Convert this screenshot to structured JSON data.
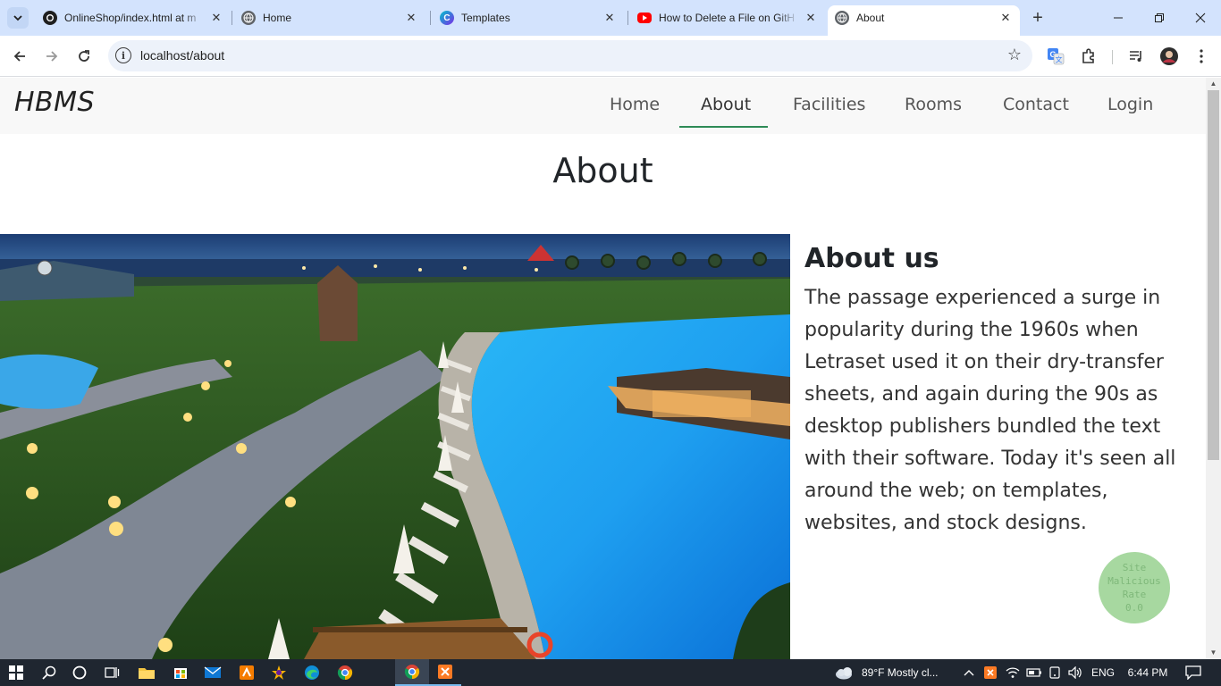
{
  "browser": {
    "tabs": [
      {
        "title": "OnlineShop/index.html at m",
        "icon": "github-icon"
      },
      {
        "title": "Home",
        "icon": "globe-icon"
      },
      {
        "title": "Templates",
        "icon": "canva-icon"
      },
      {
        "title": "How to Delete a File on GitH",
        "icon": "youtube-icon"
      },
      {
        "title": "About",
        "icon": "globe-icon",
        "active": true
      }
    ],
    "url": "localhost/about"
  },
  "site": {
    "brand": "HBMS",
    "nav": [
      "Home",
      "About",
      "Facilities",
      "Rooms",
      "Contact",
      "Login"
    ],
    "active_nav": "About",
    "accent": "#2e8b57",
    "page_title": "About",
    "about_heading": "About us",
    "about_text": "The passage experienced a surge in popularity during the 1960s when Letraset used it on their dry-transfer sheets, and again during the 90s as desktop publishers bundled the text with their software. Today it's seen all around the web; on templates, websites, and stock designs.",
    "badge": {
      "line1": "Site",
      "line2": "Malicious",
      "line3": "Rate",
      "value": "0.0"
    }
  },
  "taskbar": {
    "weather": "89°F  Mostly cl...",
    "lang": "ENG",
    "time": "6:44 PM"
  }
}
